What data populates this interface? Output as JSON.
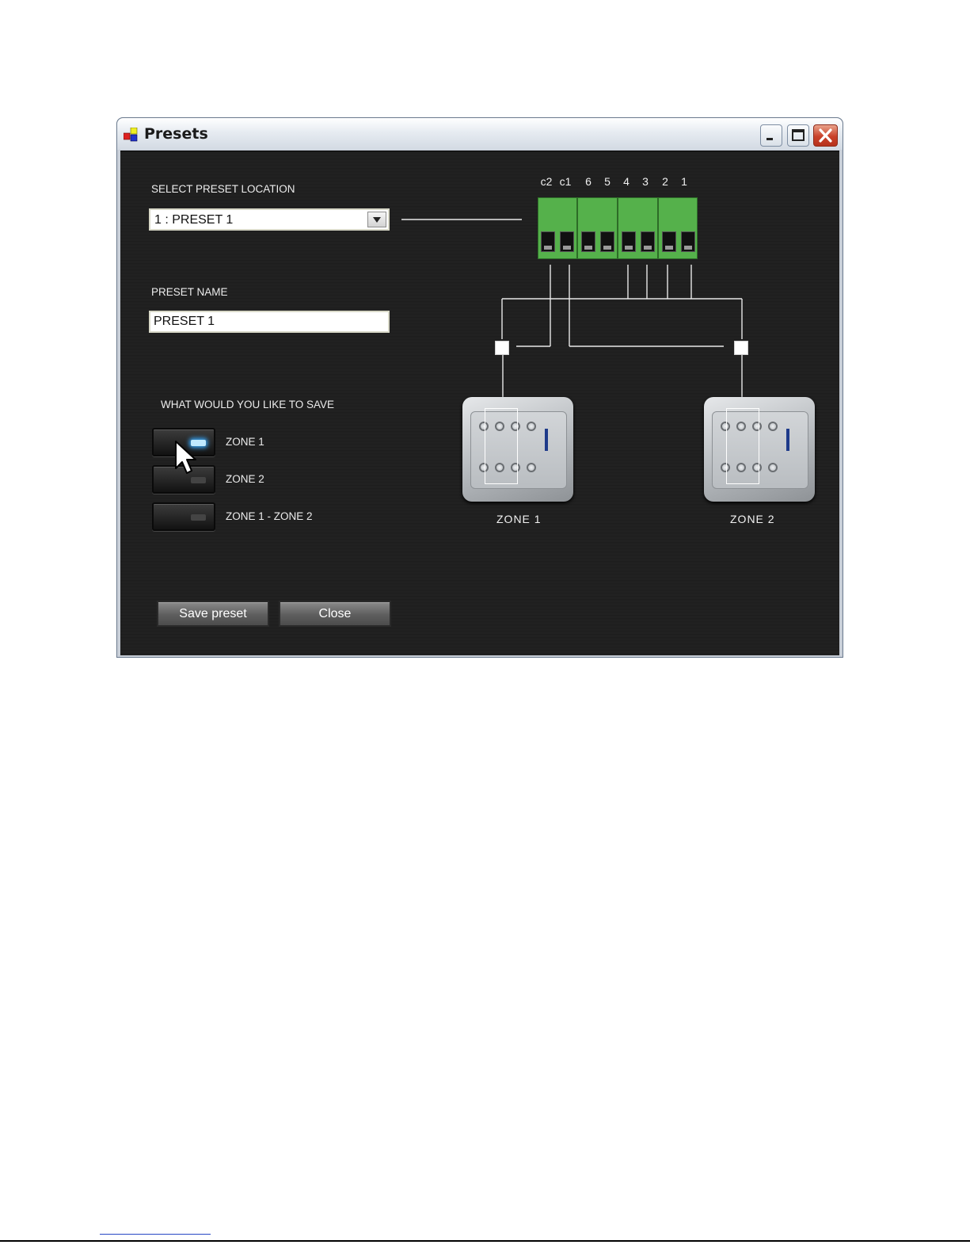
{
  "window": {
    "title": "Presets",
    "icon": "app-icon",
    "controls": [
      "minimize-icon",
      "maximize-icon",
      "close-icon"
    ]
  },
  "preset_location": {
    "label": "SELECT PRESET LOCATION",
    "selected": "1 : PRESET 1"
  },
  "preset_name": {
    "label": "PRESET NAME",
    "value": "PRESET 1"
  },
  "save_options": {
    "label": "WHAT WOULD YOU LIKE TO SAVE",
    "options": [
      {
        "label": "ZONE 1",
        "active": true
      },
      {
        "label": "ZONE 2",
        "active": false
      },
      {
        "label": "ZONE 1 - ZONE 2",
        "active": false
      }
    ]
  },
  "buttons": {
    "save": "Save preset",
    "close": "Close"
  },
  "terminal_labels": [
    "c2",
    "c1",
    "6",
    "5",
    "4",
    "3",
    "2",
    "1"
  ],
  "zones": [
    {
      "caption": "ZONE 1"
    },
    {
      "caption": "ZONE 2"
    }
  ],
  "colors": {
    "background": "#1f1f1f",
    "terminal_green": "#55b14b",
    "led_on": "#37aaff",
    "button_grey": "#5e5e5e"
  }
}
